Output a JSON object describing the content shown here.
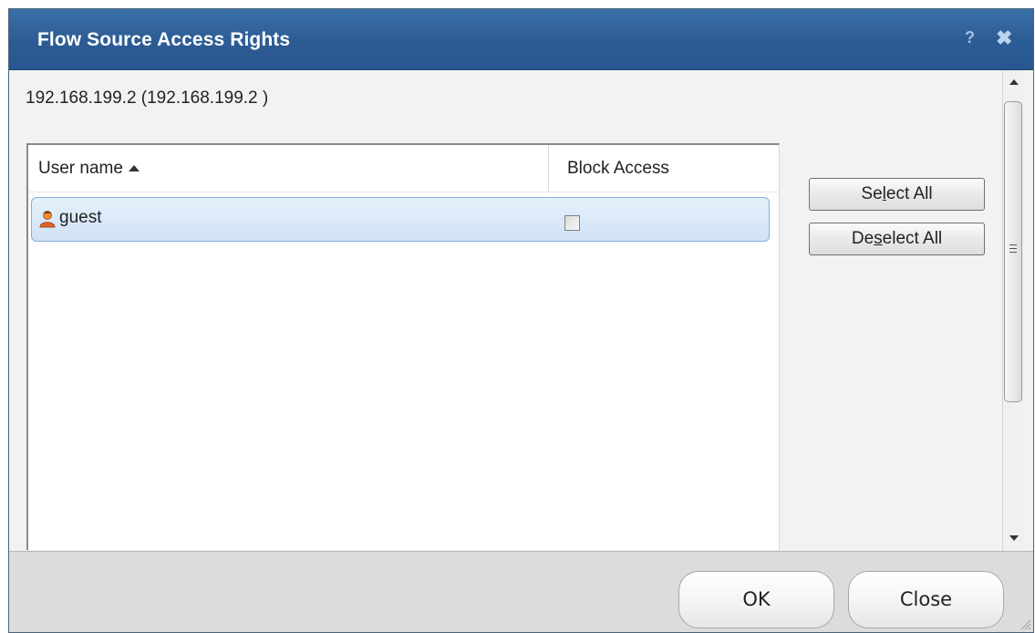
{
  "dialog": {
    "title": "Flow Source Access Rights",
    "help_glyph": "?",
    "close_glyph": "✖"
  },
  "host": {
    "label": "192.168.199.2 (192.168.199.2 )"
  },
  "table": {
    "columns": [
      "User name",
      "Block Access"
    ],
    "sort_column": "User name",
    "sort_direction": "ascending",
    "rows": [
      {
        "icon": "user-icon",
        "name": "guest",
        "block_access": false,
        "selected": true
      }
    ]
  },
  "side_buttons": {
    "select_all": {
      "before": "Se",
      "mnemonic": "l",
      "after": "ect All"
    },
    "deselect_all": {
      "before": "De",
      "mnemonic": "s",
      "after": "elect All"
    }
  },
  "footer": {
    "ok_label": "OK",
    "close_label": "Close"
  },
  "colors": {
    "titlebar": "#2d5d95",
    "selection": "#d0e2f6",
    "selection_border": "#88aede"
  }
}
